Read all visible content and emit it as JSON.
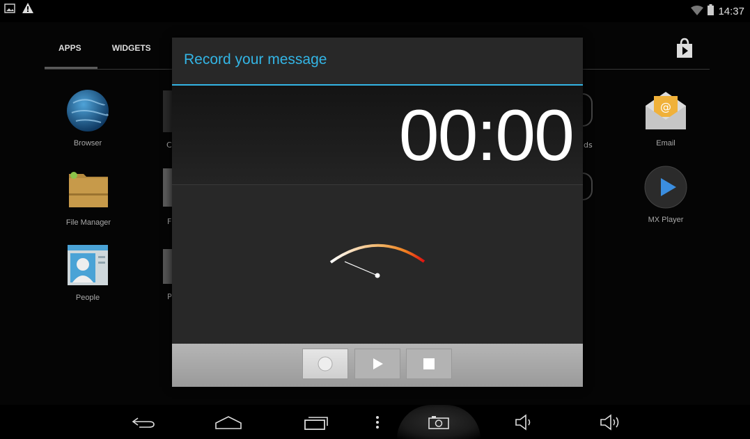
{
  "status_bar": {
    "time": "14:37",
    "icons": [
      "picture-icon",
      "warning-icon",
      "wifi-icon",
      "battery-icon"
    ]
  },
  "drawer": {
    "tabs": [
      {
        "label": "APPS",
        "active": true
      },
      {
        "label": "WIDGETS",
        "active": false
      }
    ],
    "apps": [
      {
        "label": "Browser",
        "icon": "globe-icon"
      },
      {
        "label": "File Manager",
        "icon": "folder-icon"
      },
      {
        "label": "People",
        "icon": "contact-icon"
      },
      {
        "label": "Email",
        "icon": "envelope-icon"
      },
      {
        "label": "MX Player",
        "icon": "play-circle-icon"
      }
    ],
    "partial_labels": {
      "c1": "C",
      "c2": "F",
      "c3": "P",
      "right": "ds"
    }
  },
  "dialog": {
    "title": "Record your message",
    "timer": "00:00",
    "meter_level": 0.0,
    "buttons": {
      "record": "record-icon",
      "play": "play-icon",
      "stop": "stop-icon"
    }
  },
  "nav": {
    "icons": [
      "back-icon",
      "home-icon",
      "recents-icon",
      "menu-icon",
      "camera-icon",
      "volume-down-icon",
      "volume-up-icon"
    ]
  },
  "colors": {
    "accent": "#33b5e5",
    "meter_start": "#ffffff",
    "meter_mid": "#f0a030",
    "meter_end": "#e02010"
  }
}
